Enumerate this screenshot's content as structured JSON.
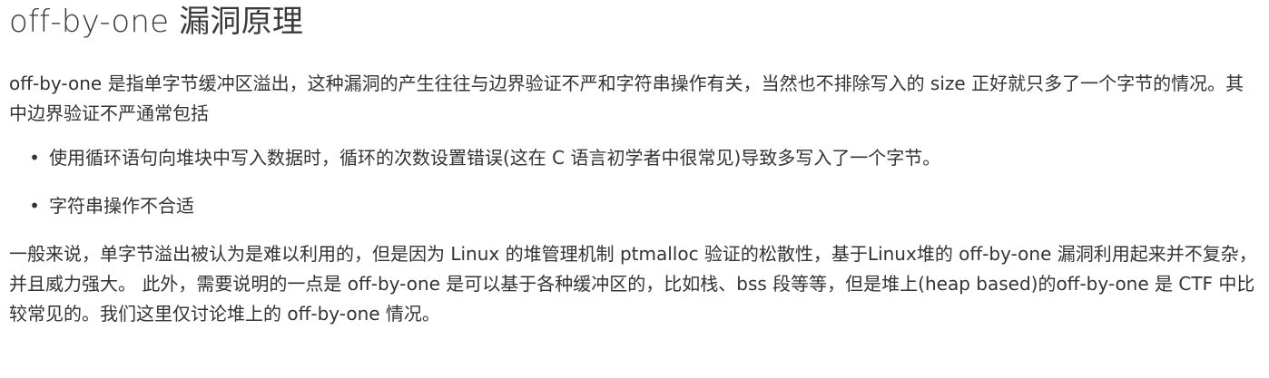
{
  "heading": "off-by-one 漏洞原理",
  "paragraph1": "off-by-one 是指单字节缓冲区溢出，这种漏洞的产生往往与边界验证不严和字符串操作有关，当然也不排除写入的 size 正好就只多了一个字节的情况。其中边界验证不严通常包括",
  "bullets": [
    "使用循环语句向堆块中写入数据时，循环的次数设置错误(这在 C 语言初学者中很常见)导致多写入了一个字节。",
    "字符串操作不合适"
  ],
  "bullet_glyph": "•",
  "paragraph2": "一般来说，单字节溢出被认为是难以利用的，但是因为 Linux 的堆管理机制 ptmalloc 验证的松散性，基于Linux堆的 off-by-one 漏洞利用起来并不复杂，并且威力强大。 此外，需要说明的一点是 off-by-one 是可以基于各种缓冲区的，比如栈、bss 段等等，但是堆上(heap based)的off-by-one 是 CTF 中比较常见的。我们这里仅讨论堆上的 off-by-one 情况。"
}
